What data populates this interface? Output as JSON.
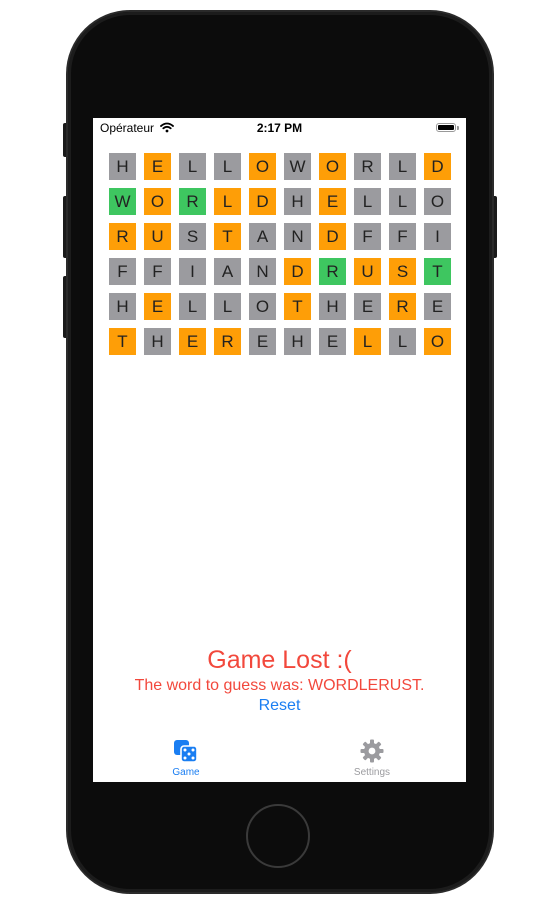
{
  "status_bar": {
    "carrier": "Opérateur",
    "time": "2:17 PM",
    "wifi_icon": "wifi-icon",
    "battery_icon": "battery-icon"
  },
  "colors": {
    "orange": "#fe9e07",
    "gray": "#9b9b9f",
    "green": "#3ec660",
    "result_red": "#f2483c",
    "link_blue": "#1a7ef2",
    "tab_inactive": "#9b9b9f"
  },
  "board": {
    "rows": [
      [
        [
          "H",
          "gray"
        ],
        [
          "E",
          "orange"
        ],
        [
          "L",
          "gray"
        ],
        [
          "L",
          "gray"
        ],
        [
          "O",
          "orange"
        ],
        [
          "W",
          "gray"
        ],
        [
          "O",
          "orange"
        ],
        [
          "R",
          "gray"
        ],
        [
          "L",
          "gray"
        ],
        [
          "D",
          "orange"
        ]
      ],
      [
        [
          "W",
          "green"
        ],
        [
          "O",
          "orange"
        ],
        [
          "R",
          "green"
        ],
        [
          "L",
          "orange"
        ],
        [
          "D",
          "orange"
        ],
        [
          "H",
          "gray"
        ],
        [
          "E",
          "orange"
        ],
        [
          "L",
          "gray"
        ],
        [
          "L",
          "gray"
        ],
        [
          "O",
          "gray"
        ]
      ],
      [
        [
          "R",
          "orange"
        ],
        [
          "U",
          "orange"
        ],
        [
          "S",
          "gray"
        ],
        [
          "T",
          "orange"
        ],
        [
          "A",
          "gray"
        ],
        [
          "N",
          "gray"
        ],
        [
          "D",
          "orange"
        ],
        [
          "F",
          "gray"
        ],
        [
          "F",
          "gray"
        ],
        [
          "I",
          "gray"
        ]
      ],
      [
        [
          "F",
          "gray"
        ],
        [
          "F",
          "gray"
        ],
        [
          "I",
          "gray"
        ],
        [
          "A",
          "gray"
        ],
        [
          "N",
          "gray"
        ],
        [
          "D",
          "orange"
        ],
        [
          "R",
          "green"
        ],
        [
          "U",
          "orange"
        ],
        [
          "S",
          "orange"
        ],
        [
          "T",
          "green"
        ]
      ],
      [
        [
          "H",
          "gray"
        ],
        [
          "E",
          "orange"
        ],
        [
          "L",
          "gray"
        ],
        [
          "L",
          "gray"
        ],
        [
          "O",
          "gray"
        ],
        [
          "T",
          "orange"
        ],
        [
          "H",
          "gray"
        ],
        [
          "E",
          "gray"
        ],
        [
          "R",
          "orange"
        ],
        [
          "E",
          "gray"
        ]
      ],
      [
        [
          "T",
          "orange"
        ],
        [
          "H",
          "gray"
        ],
        [
          "E",
          "orange"
        ],
        [
          "R",
          "orange"
        ],
        [
          "E",
          "gray"
        ],
        [
          "H",
          "gray"
        ],
        [
          "E",
          "gray"
        ],
        [
          "L",
          "orange"
        ],
        [
          "L",
          "gray"
        ],
        [
          "O",
          "orange"
        ]
      ]
    ]
  },
  "result": {
    "title": "Game Lost :(",
    "message": "The word to guess was: WORDLERUST.",
    "reset_label": "Reset"
  },
  "tab_bar": {
    "tabs": [
      {
        "label": "Game",
        "icon": "dice-icon",
        "selected": true
      },
      {
        "label": "Settings",
        "icon": "gear-icon",
        "selected": false
      }
    ]
  }
}
